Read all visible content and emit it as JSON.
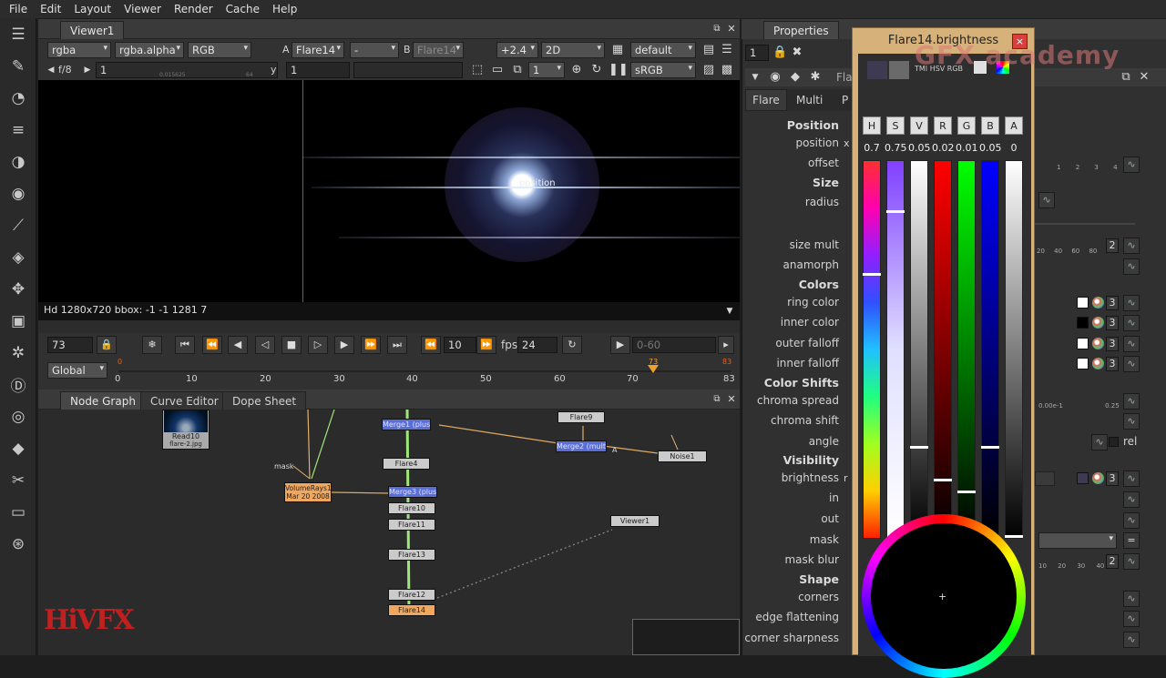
{
  "menu": [
    "File",
    "Edit",
    "Layout",
    "Viewer",
    "Render",
    "Cache",
    "Help"
  ],
  "viewer": {
    "tab": "Viewer1",
    "channels": "rgba",
    "alpha_channel": "rgba.alpha",
    "display": "RGB",
    "input_a_label": "A",
    "input_a": "Flare14",
    "input_dash": "-",
    "input_b_label": "B",
    "input_b": "Flare14",
    "gain": "+2.4",
    "view_mode": "2D",
    "lut": "default",
    "fstop": "f/8",
    "frame_field": "1",
    "y_label": "y",
    "y_value": "1",
    "proxy": "1",
    "colorspace": "sRGB",
    "slider_ticks": [
      "0.015625",
      "0.5",
      "1",
      "10",
      "64"
    ],
    "overlay_label": "position",
    "info_bar": "Hd 1280x720 bbox: -1 -1 1281 7"
  },
  "timeline": {
    "current_frame": "73",
    "step": "10",
    "fps_label": "fps",
    "fps": "24",
    "range": "0-60",
    "mode": "Global",
    "ticks": [
      "0",
      "10",
      "20",
      "30",
      "40",
      "50",
      "60",
      "70",
      "83"
    ],
    "marker_frame": "73",
    "start_marker": "0",
    "end_marker": "83"
  },
  "nodegraph": {
    "tabs": [
      "Node Graph",
      "Curve Editor",
      "Dope Sheet"
    ],
    "nodes": [
      {
        "id": "read10",
        "label": "Read10",
        "sub": "flare-2.jpg"
      },
      {
        "id": "merge1",
        "label": "Merge1 (plus)"
      },
      {
        "id": "flare9",
        "label": "Flare9"
      },
      {
        "id": "merge2",
        "label": "Merge2 (multiply)"
      },
      {
        "id": "noise1",
        "label": "Noise1"
      },
      {
        "id": "flare4",
        "label": "Flare4"
      },
      {
        "id": "volumerays",
        "label": "VolumeRays1",
        "sub": "Mar 20 2008"
      },
      {
        "id": "merge3",
        "label": "Merge3 (plus)"
      },
      {
        "id": "flare10",
        "label": "Flare10"
      },
      {
        "id": "flare11",
        "label": "Flare11"
      },
      {
        "id": "viewer1",
        "label": "Viewer1"
      },
      {
        "id": "flare13",
        "label": "Flare13"
      },
      {
        "id": "flare12",
        "label": "Flare12"
      },
      {
        "id": "flare14",
        "label": "Flare14"
      }
    ],
    "mask_label": "mask",
    "pipe_a": "A",
    "pipe_b": "B"
  },
  "properties": {
    "tab": "Properties",
    "count": "1",
    "node_name_partial": "Fla",
    "subtabs": [
      "Flare",
      "Multi",
      "P"
    ],
    "params": [
      {
        "label": "Position",
        "section": true
      },
      {
        "label": "position",
        "suffix": "x"
      },
      {
        "label": "offset"
      },
      {
        "label": "Size",
        "section": true
      },
      {
        "label": "radius"
      },
      {
        "label": "size mult"
      },
      {
        "label": "anamorph"
      },
      {
        "label": "Colors",
        "section": true
      },
      {
        "label": "ring color"
      },
      {
        "label": "inner color"
      },
      {
        "label": "outer falloff"
      },
      {
        "label": "inner falloff"
      },
      {
        "label": "Color Shifts",
        "section": true
      },
      {
        "label": "chroma spread"
      },
      {
        "label": "chroma shift"
      },
      {
        "label": "angle"
      },
      {
        "label": "Visibility",
        "section": true
      },
      {
        "label": "brightness",
        "suffix": "r"
      },
      {
        "label": "in"
      },
      {
        "label": "out"
      },
      {
        "label": "mask"
      },
      {
        "label": "mask blur"
      },
      {
        "label": "Shape",
        "section": true
      },
      {
        "label": "corners"
      },
      {
        "label": "edge flattening"
      },
      {
        "label": "corner sharpness"
      }
    ],
    "right_values": {
      "size_mult_count": "2",
      "ring_n": "3",
      "inner_n": "3",
      "outer_n": "3",
      "inner_f_n": "3",
      "brightness_n": "3",
      "mask_blur_n": "2",
      "rel_label": "rel"
    },
    "scale_ticks_a": [
      "1",
      "2",
      "3",
      "4",
      "5"
    ],
    "scale_ticks_b": [
      "20",
      "40",
      "60",
      "80",
      "100"
    ],
    "chroma_values": [
      "0.00e-1",
      "0.25"
    ],
    "scale_ticks_c": [
      "10",
      "20",
      "30",
      "40"
    ]
  },
  "colorpicker": {
    "title": "Flare14.brightness",
    "modes_label": "TMI HSV RGB",
    "channels": [
      "H",
      "S",
      "V",
      "R",
      "G",
      "B",
      "A"
    ],
    "values": [
      "0.7",
      "0.75",
      "0.05",
      "0.02",
      "0.01",
      "0.05",
      "0"
    ],
    "colors": {
      "swatch_old": "#3d3a52",
      "swatch_new": "#6a6a6a",
      "frame": "#d6b27a"
    }
  },
  "watermarks": {
    "top": "GFX academy",
    "bottom": "HiVFX"
  }
}
